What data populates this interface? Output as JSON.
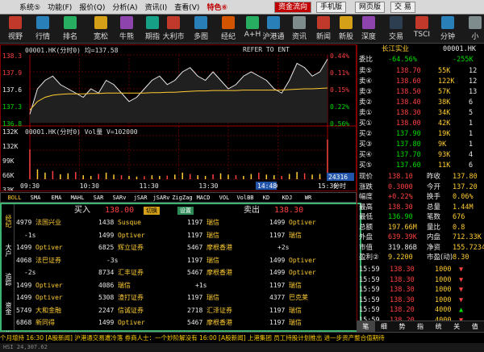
{
  "menubar": {
    "items": [
      "系统⑤",
      "功能(F)",
      "报价(Q)",
      "分析(A)",
      "资讯(I)",
      "查看(V)",
      "特色⑥"
    ],
    "capital_flow": "资金流向",
    "mobile": "手机版",
    "web": "网页版",
    "trade": "交 易"
  },
  "toolbar": {
    "buttons": [
      "视野",
      "行情",
      "排名",
      "宽松",
      "牛熊",
      "期指",
      "大利市",
      "多图",
      "经纪",
      "A+H",
      "沪港通",
      "资讯",
      "新闻",
      "新股",
      "深度",
      "交易",
      "TSCI",
      "分钟",
      "小"
    ]
  },
  "chart": {
    "top_header": "00001.HK(分时0) 均=137.58",
    "refer": "REFER TO ENT",
    "y_left": [
      "138.3",
      "137.9",
      "137.6",
      "137.3",
      "136.8"
    ],
    "y_right": [
      "0.44%",
      "0.11%",
      "0.15%",
      "0.22%",
      "0.56%"
    ],
    "vol_header": "00001.HK(分时0) Vol量 V=102000",
    "vol_y": [
      "132K",
      "132K",
      "99K",
      "66K",
      "33K"
    ],
    "times": [
      "09:30",
      "10:30",
      "11:30",
      "13:30",
      "14:30",
      "15:30"
    ],
    "cursor_time": "14:48",
    "cursor_vol": "24316",
    "cursor_tag": "分时",
    "price_line": [
      137.0,
      137.6,
      137.8,
      137.9,
      137.7,
      137.6,
      137.5,
      137.4,
      137.6,
      137.5,
      137.8,
      137.7,
      137.5,
      137.3,
      137.4,
      137.6,
      137.8,
      137.9,
      137.7,
      137.8,
      138.0,
      138.1,
      137.9,
      137.8,
      138.0,
      137.8,
      137.6,
      137.7,
      137.9,
      138.0,
      137.9,
      137.8,
      137.6,
      137.5,
      137.8,
      138.2,
      138.1,
      137.9,
      138.0,
      138.3
    ],
    "avg_line": [
      137.1,
      137.3,
      137.4,
      137.45,
      137.47,
      137.48,
      137.48,
      137.48,
      137.49,
      137.49,
      137.5,
      137.5,
      137.5,
      137.5,
      137.5,
      137.5,
      137.51,
      137.51,
      137.52,
      137.52,
      137.53,
      137.54,
      137.55,
      137.55,
      137.56,
      137.56,
      137.56,
      137.56,
      137.57,
      137.57,
      137.57,
      137.57,
      137.57,
      137.57,
      137.58,
      137.59,
      137.6,
      137.6,
      137.61,
      137.62
    ],
    "volumes": [
      90,
      30,
      20,
      25,
      15,
      18,
      22,
      12,
      10,
      16,
      20,
      14,
      12,
      10,
      8,
      9,
      12,
      10,
      11,
      14,
      20,
      16,
      12,
      10,
      15,
      18,
      14,
      12,
      10,
      16,
      20,
      14,
      12,
      10,
      16,
      22,
      18,
      14,
      16,
      120
    ]
  },
  "indicators": [
    "BOLL",
    "SMA",
    "EMA",
    "MAHL",
    "SAR",
    "SARv",
    "jSAR",
    "jSARv",
    "ZigZag",
    "MACD",
    "VOL",
    "VolBB",
    "KD",
    "KDJ",
    "WR"
  ],
  "broker": {
    "sidetabs": [
      "经纪",
      "大户",
      "追踪",
      "资金",
      "指标"
    ],
    "buy_label": "买入",
    "buy_price": "138.00",
    "sell_label": "卖出",
    "sell_price": "138.30",
    "switch_btn": "切换",
    "setting_btn": "设置",
    "left_rows": [
      [
        "4979",
        "法国兴业",
        "1438",
        "Susque"
      ],
      [
        "-1s",
        "",
        "1499",
        "Optiver"
      ],
      [
        "1499",
        "Optiver",
        "6825",
        "辉立证券"
      ],
      [
        "4068",
        "法巴证券",
        "-3s",
        ""
      ],
      [
        "-2s",
        "",
        "8734",
        "汇丰证券"
      ],
      [
        "1499",
        "Optiver",
        "4086",
        "瑞信"
      ],
      [
        "1499",
        "Optiver",
        "5308",
        "渣打证券"
      ],
      [
        "5749",
        "大和金融",
        "2247",
        "信诚证券"
      ],
      [
        "6868",
        "新同得",
        "1499",
        "Optiver"
      ]
    ],
    "right_rows": [
      [
        "1197",
        "瑞信",
        "1499",
        "Optiver"
      ],
      [
        "1197",
        "瑞信",
        "1197",
        "瑞信"
      ],
      [
        "5467",
        "摩根香港",
        "+2s",
        ""
      ],
      [
        "1197",
        "瑞信",
        "1499",
        "Optiver"
      ],
      [
        "5467",
        "摩根香港",
        "1499",
        "Optiver"
      ],
      [
        "+1s",
        "",
        "1197",
        "瑞信"
      ],
      [
        "1197",
        "瑞信",
        "4377",
        "巴克莱"
      ],
      [
        "2718",
        "汇泽证券",
        "1197",
        "瑞信"
      ],
      [
        "5467",
        "摩根香港",
        "1197",
        "瑞信"
      ]
    ]
  },
  "right": {
    "code": "00001.HK",
    "name": "长江实业",
    "weibi": "委比",
    "weibi_val": "-64.56%",
    "weicha": "-255K",
    "asks": [
      [
        "卖⑤",
        "138.70",
        "55K",
        "12"
      ],
      [
        "卖④",
        "138.60",
        "122K",
        "12"
      ],
      [
        "卖③",
        "138.50",
        "57K",
        "13"
      ],
      [
        "卖②",
        "138.40",
        "38K",
        "6"
      ],
      [
        "卖①",
        "138.30",
        "34K",
        "5"
      ]
    ],
    "bids": [
      [
        "买①",
        "138.00",
        "42K",
        "1"
      ],
      [
        "买②",
        "137.90",
        "19K",
        "1"
      ],
      [
        "买③",
        "137.80",
        "9K",
        "1"
      ],
      [
        "买④",
        "137.70",
        "93K",
        "4"
      ],
      [
        "买⑤",
        "137.60",
        "11K",
        "6"
      ]
    ],
    "stats": [
      [
        "现价",
        "138.10",
        "昨收",
        "137.80"
      ],
      [
        "涨跌",
        "0.3000",
        "今开",
        "137.20"
      ],
      [
        "幅度",
        "+0.22%",
        "换手",
        "0.06%"
      ],
      [
        "最高",
        "138.30",
        "总量",
        "1.44M"
      ],
      [
        "最低",
        "136.90",
        "笔数",
        "676"
      ],
      [
        "总额",
        "197.66M",
        "量比",
        "0.8"
      ],
      [
        "外盘",
        "639.39K",
        "内盘",
        "712.33K"
      ],
      [
        "市值",
        "319.86B",
        "净资",
        "155.7234"
      ],
      [
        "盈利②",
        "9.2200",
        "市盈(动)",
        "8.30"
      ]
    ],
    "ticks": [
      [
        "15:59",
        "138.30",
        "1000",
        "S"
      ],
      [
        "15:59",
        "138.30",
        "1000",
        "S"
      ],
      [
        "15:59",
        "138.30",
        "1000",
        "S"
      ],
      [
        "15:59",
        "138.30",
        "1000",
        "S"
      ],
      [
        "15:59",
        "138.20",
        "4000",
        "B"
      ],
      [
        "15:59",
        "138.20",
        "4000",
        "S"
      ]
    ],
    "tabs": [
      "笔",
      "细",
      "势",
      "指",
      "统",
      "关",
      "值"
    ]
  },
  "ticker": "个月增持  16:30 [A股新闻] 沪港通交易遭冷落 券商人士：一个妙阶解没有  16:00 [A股新闻] 上港集团 员工持股计划推出 进一步资产整合值期待",
  "bottom": "HSI 24,307.62"
}
